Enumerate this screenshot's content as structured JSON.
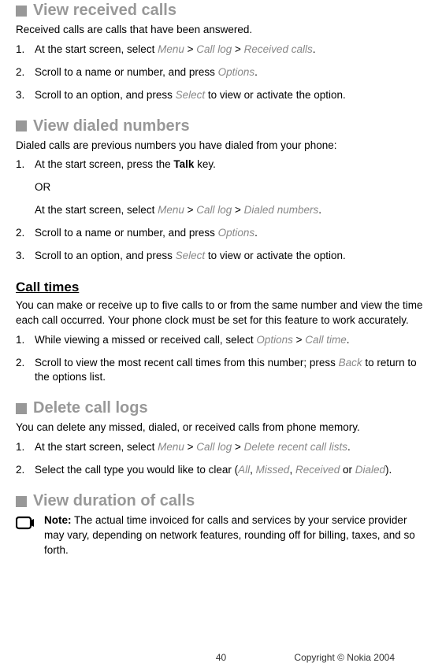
{
  "sections": {
    "received": {
      "heading": "View received calls",
      "intro": "Received calls are calls that have been answered.",
      "steps": {
        "s1": {
          "num": "1.",
          "pre": "At the start screen, select ",
          "m1": "Menu",
          "sep1": " > ",
          "m2": "Call log",
          "sep2": " > ",
          "m3": "Received calls",
          "post": "."
        },
        "s2": {
          "num": "2.",
          "pre": "Scroll to a name or number, and press ",
          "m1": "Options",
          "post": "."
        },
        "s3": {
          "num": "3.",
          "pre": "Scroll to an option, and press ",
          "m1": "Select",
          "post": " to view or activate the option."
        }
      }
    },
    "dialed": {
      "heading": "View dialed numbers",
      "intro": "Dialed calls are previous numbers you have dialed from your phone:",
      "steps": {
        "s1": {
          "num": "1.",
          "pre": "At the start screen, press the ",
          "bold": "Talk",
          "post": " key."
        },
        "or": "OR",
        "s1b": {
          "pre": "At the start screen, select ",
          "m1": "Menu",
          "sep1": " > ",
          "m2": "Call log",
          "sep2": " > ",
          "m3": "Dialed numbers",
          "post": "."
        },
        "s2": {
          "num": "2.",
          "pre": "Scroll to a name or number, and press ",
          "m1": "Options",
          "post": "."
        },
        "s3": {
          "num": "3.",
          "pre": "Scroll to an option, and press ",
          "m1": "Select",
          "post": " to view or activate the option."
        }
      }
    },
    "calltimes": {
      "heading": "Call times",
      "intro": "You can make or receive up to five calls to or from the same number and view the time each call occurred. Your phone clock must be set for this feature to work accurately.",
      "steps": {
        "s1": {
          "num": "1.",
          "pre": "While viewing a missed or received call, select ",
          "m1": "Options",
          "sep1": " > ",
          "m2": "Call time",
          "post": "."
        },
        "s2": {
          "num": "2.",
          "pre": "Scroll to view the most recent call times from this number; press ",
          "m1": "Back",
          "post": " to return to the options list."
        }
      }
    },
    "delete": {
      "heading": "Delete call logs",
      "intro": "You can delete any missed, dialed, or received calls from phone memory.",
      "steps": {
        "s1": {
          "num": "1.",
          "pre": "At the start screen, select ",
          "m1": "Menu",
          "sep1": " > ",
          "m2": "Call log",
          "sep2": " > ",
          "m3": "Delete recent call lists",
          "post": "."
        },
        "s2": {
          "num": "2.",
          "pre": "Select the call type you would like to clear (",
          "m1": "All",
          "sep1": ", ",
          "m2": "Missed",
          "sep2": ", ",
          "m3": "Received",
          "sep3": " or ",
          "m4": "Dialed",
          "post": ")."
        }
      }
    },
    "duration": {
      "heading": "View duration of calls",
      "note": {
        "bold": "Note:",
        "text": " The actual time invoiced for calls and services by your service provider may vary, depending on network features, rounding off for billing, taxes, and so forth."
      }
    }
  },
  "footer": {
    "page": "40",
    "copyright": "Copyright © Nokia 2004"
  }
}
